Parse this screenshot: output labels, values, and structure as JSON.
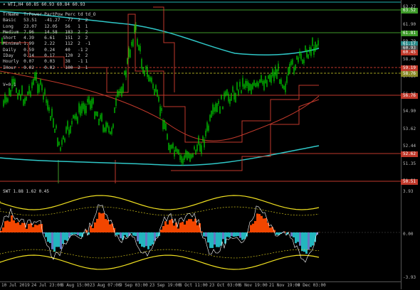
{
  "main": {
    "title": "WTI,H4  60.85 60.93 60.84 60.93",
    "stats_header": [
      "TrName",
      "TrPower",
      "PartPow",
      "Perc",
      "td",
      "td_O"
    ],
    "stats_rows": [
      [
        "Basic",
        "53.51",
        "-41.27",
        "-77",
        "2",
        "2"
      ],
      [
        "Long",
        "23.07",
        "12.05",
        "56",
        "1",
        "1"
      ],
      [
        "Medium",
        "7.96",
        "14.58",
        "183",
        "2",
        "2"
      ],
      [
        "Short",
        "4.39",
        "6.61",
        "151",
        "2",
        "2"
      ],
      [
        "Minimal",
        "1.99",
        "2.22",
        "112",
        "2",
        "-1"
      ],
      [
        "Daily",
        "0.59",
        "0.24",
        "40",
        "-1",
        "2"
      ],
      [
        "IDay",
        "0.14",
        "0.17",
        "120",
        "2",
        "2"
      ],
      [
        "Hourly",
        "0.07",
        "0.03",
        "38",
        "-1",
        "1"
      ],
      [
        "IHour",
        "0.02",
        "0.02",
        "100",
        "2",
        "1"
      ]
    ],
    "v_label": "V=0.1",
    "axis_labels": [
      "63.27",
      "61.90",
      "59.79",
      "58.46",
      "57.30",
      "56.10",
      "54.90",
      "53.62",
      "52.44",
      "51.35",
      "50.21"
    ],
    "price_tags": [
      {
        "text": "63.52",
        "color": "#3e9a2a"
      },
      {
        "text": "61.81",
        "color": "#3e9a2a"
      },
      {
        "text": "61.17",
        "color": "#2a8a8a"
      },
      {
        "text": "60.93",
        "color": "#4a4a4a"
      },
      {
        "text": "60.45",
        "color": "#c0392b"
      },
      {
        "text": "59.19",
        "color": "#c0392b"
      },
      {
        "text": "58.76",
        "color": "#8a8a2a"
      },
      {
        "text": "56.76",
        "color": "#c0392b"
      },
      {
        "text": "52.62",
        "color": "#c0392b"
      },
      {
        "text": "50.51",
        "color": "#c0392b"
      }
    ]
  },
  "sub": {
    "title": "SWT 1.88 1.62 0.45",
    "axis_labels": [
      "3.93",
      "0.00",
      "-3.93"
    ]
  },
  "x_axis": [
    "10 Jul 2019",
    "24 Jul 23:00",
    "8 Aug 15:00",
    "23 Aug 07:00",
    "9 Sep 03:00",
    "23 Sep 19:00",
    "8 Oct 11:00",
    "23 Oct 03:00",
    "6 Nov 19:00",
    "21 Nov 19:00",
    "9 Dec 03:00"
  ],
  "colors": {
    "candle": "#00e000",
    "cyan_line": "#2fc7c7",
    "red_line": "#c0392b",
    "yellow_band": "#f0e020",
    "orange_fill": "#ff4a00",
    "cyan_fill": "#25c0c8",
    "blue_fill": "#6a7fd0"
  }
}
